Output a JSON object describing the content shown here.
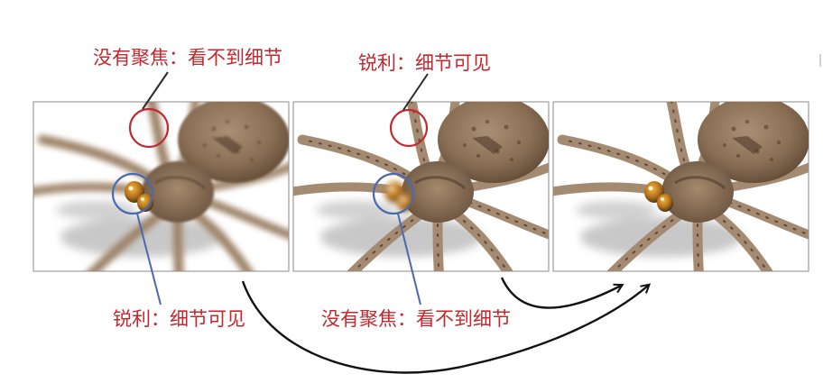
{
  "labels": {
    "top_left": "没有聚焦：看不到细节",
    "top_middle": "锐利：细节可见",
    "bottom_left": "锐利：细节可见",
    "bottom_middle": "没有聚焦：看不到细节"
  },
  "colors": {
    "red": "#c3282e",
    "blue": "#4a69b0",
    "arrow": "#111111",
    "panel_border": "#8a8a8a"
  },
  "panels": [
    {
      "name": "focus-on-eyes",
      "legs_sharp": false,
      "eyes_sharp": true
    },
    {
      "name": "focus-on-legs",
      "legs_sharp": true,
      "eyes_sharp": false
    },
    {
      "name": "all-in-focus",
      "legs_sharp": true,
      "eyes_sharp": true
    }
  ],
  "icons": {
    "red_circle": "circle-outline",
    "blue_circle": "circle-outline",
    "arrows": "curved-arrow"
  }
}
